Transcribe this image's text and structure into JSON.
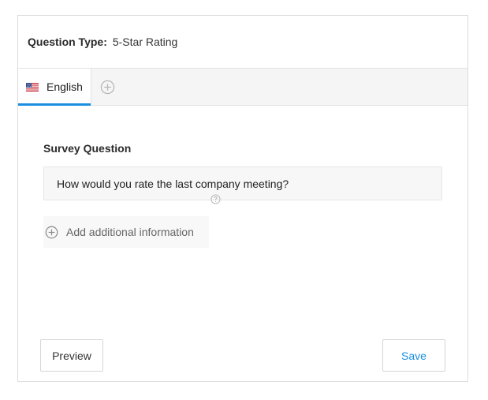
{
  "question_type": {
    "label": "Question Type:",
    "value": "5-Star Rating"
  },
  "tabs": [
    {
      "label": "English",
      "icon": "us-flag-icon",
      "active": true
    }
  ],
  "add_language_icon": "circle-plus-icon",
  "survey_question": {
    "label": "Survey Question",
    "value": "How would you rate the last company meeting?"
  },
  "add_info": {
    "label": "Add additional information",
    "icon": "circle-plus-icon",
    "help_icon": "question-circle-icon"
  },
  "buttons": {
    "preview": "Preview",
    "save": "Save"
  },
  "colors": {
    "accent": "#1a8fe0",
    "tab_bar_bg": "#f5f5f5",
    "input_bg": "#f7f7f7"
  }
}
